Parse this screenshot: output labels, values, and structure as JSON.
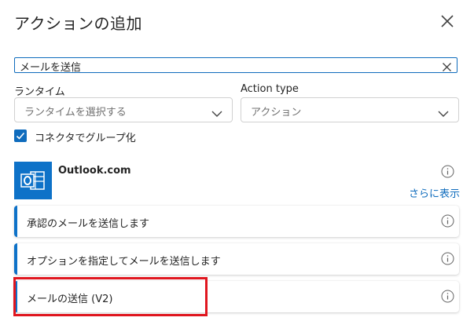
{
  "dialog": {
    "title": "アクションの追加"
  },
  "search": {
    "value": "メールを送信"
  },
  "filters": {
    "runtime_label": "ランタイム",
    "runtime_placeholder": "ランタイムを選択する",
    "action_type_label": "Action type",
    "action_type_value": "アクション"
  },
  "group_by_connector": {
    "label": "コネクタでグループ化",
    "checked": true
  },
  "connector": {
    "name": "Outlook.com",
    "more_link": "さらに表示",
    "brand_color": "#0e72c8"
  },
  "actions": [
    {
      "label": "承認のメールを送信します"
    },
    {
      "label": "オプションを指定してメールを送信します"
    },
    {
      "label": "メールの送信 (V2)"
    }
  ],
  "colors": {
    "accent": "#0f6cbd",
    "highlight": "#e0161f"
  }
}
